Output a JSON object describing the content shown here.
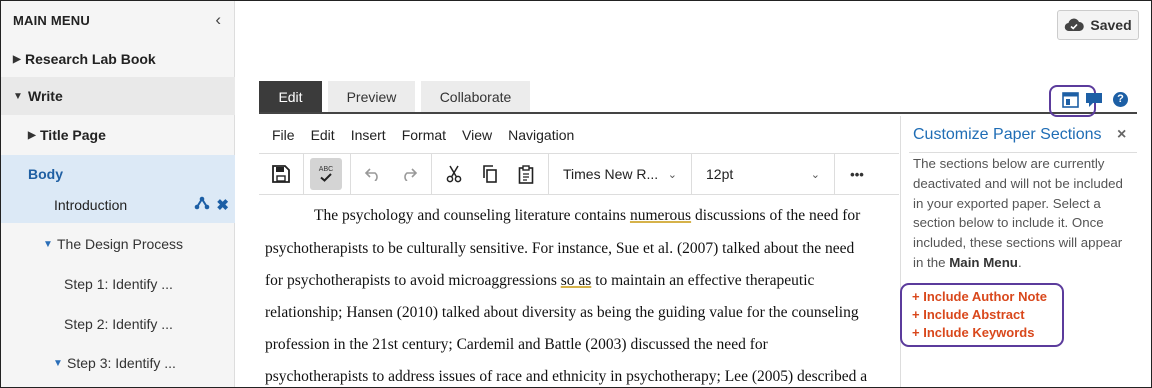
{
  "sidebar": {
    "header": "MAIN MENU",
    "items": [
      {
        "label": "Research Lab Book"
      },
      {
        "label": "Write"
      },
      {
        "label": "Title Page"
      },
      {
        "label": "Body"
      },
      {
        "label": "Introduction"
      },
      {
        "label": "The Design Process"
      },
      {
        "label": "Step 1: Identify ..."
      },
      {
        "label": "Step 2: Identify ..."
      },
      {
        "label": "Step 3: Identify ..."
      }
    ]
  },
  "status": {
    "saved_label": "Saved"
  },
  "tabs": [
    {
      "label": "Edit"
    },
    {
      "label": "Preview"
    },
    {
      "label": "Collaborate"
    }
  ],
  "menubar": [
    "File",
    "Edit",
    "Insert",
    "Format",
    "View",
    "Navigation"
  ],
  "toolbar": {
    "spell_label": "ABC",
    "font_family": "Times New R...",
    "font_size": "12pt",
    "more": "•••"
  },
  "document": {
    "lines": [
      {
        "before": "The psychology and counseling literature contains ",
        "mark": "numerous",
        "after": " discussions of the need for"
      },
      {
        "before": "psychotherapists to be culturally sensitive. For instance, Sue et al. (2007) talked about the need",
        "mark": "",
        "after": ""
      },
      {
        "before": "for psychotherapists to avoid microaggressions ",
        "mark": "so as",
        "after": " to maintain an effective therapeutic"
      },
      {
        "before": "relationship; Hansen (2010) talked about diversity as being the guiding value for the counseling",
        "mark": "",
        "after": ""
      },
      {
        "before": "profession in the 21st century; Cardemil and Battle (2003) discussed the need for",
        "mark": "",
        "after": ""
      },
      {
        "before": "psychotherapists to address issues of race and ethnicity in psychotherapy; Lee (2005) described a",
        "mark": "",
        "after": ""
      }
    ]
  },
  "customize": {
    "title": "Customize Paper Sections",
    "close": "×",
    "desc_lines": [
      "The sections below are currently",
      "deactivated and will not be included",
      "in your exported paper. Select a",
      "section below to include it. Once",
      "included, these sections will appear"
    ],
    "desc_last_prefix": "in the ",
    "desc_last_bold": "Main Menu",
    "desc_last_suffix": ".",
    "include_items": [
      "Include Author Note",
      "Include Abstract",
      "Include Keywords"
    ]
  },
  "colors": {
    "accent_blue": "#1f6db5",
    "include_orange": "#d9481c",
    "highlight_purple": "#5b3b9c",
    "active_tab": "#3b3b3b"
  }
}
